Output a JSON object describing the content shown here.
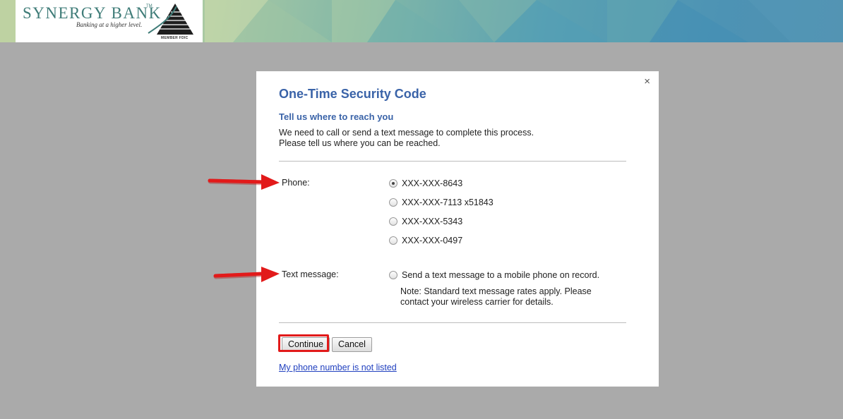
{
  "brand": {
    "name": "SYNERGY BANK",
    "trademark": "TM",
    "tagline": "Banking at a higher level.",
    "fdic": "MEMBER FDIC"
  },
  "dialog": {
    "close_label": "×",
    "title": "One-Time Security Code",
    "subtitle": "Tell us where to reach you",
    "description_line1": "We need to call or send a text message to complete this process.",
    "description_line2": "Please tell us where you can be reached.",
    "phone_label": "Phone:",
    "phone_options": [
      {
        "label": "XXX-XXX-8643",
        "selected": true
      },
      {
        "label": "XXX-XXX-7113 x51843",
        "selected": false
      },
      {
        "label": "XXX-XXX-5343",
        "selected": false
      },
      {
        "label": "XXX-XXX-0497",
        "selected": false
      }
    ],
    "text_label": "Text message:",
    "text_option": "Send a text message to a mobile phone on record.",
    "note_line1": "Note: Standard text message rates apply. Please",
    "note_line2": "contact your wireless carrier for details.",
    "continue_label": "Continue",
    "cancel_label": "Cancel",
    "not_listed_link": "My phone number is not listed"
  },
  "colors": {
    "title": "#3a63a8",
    "annotation_red": "#e21a1a",
    "overlay": "#aaaaaa"
  }
}
